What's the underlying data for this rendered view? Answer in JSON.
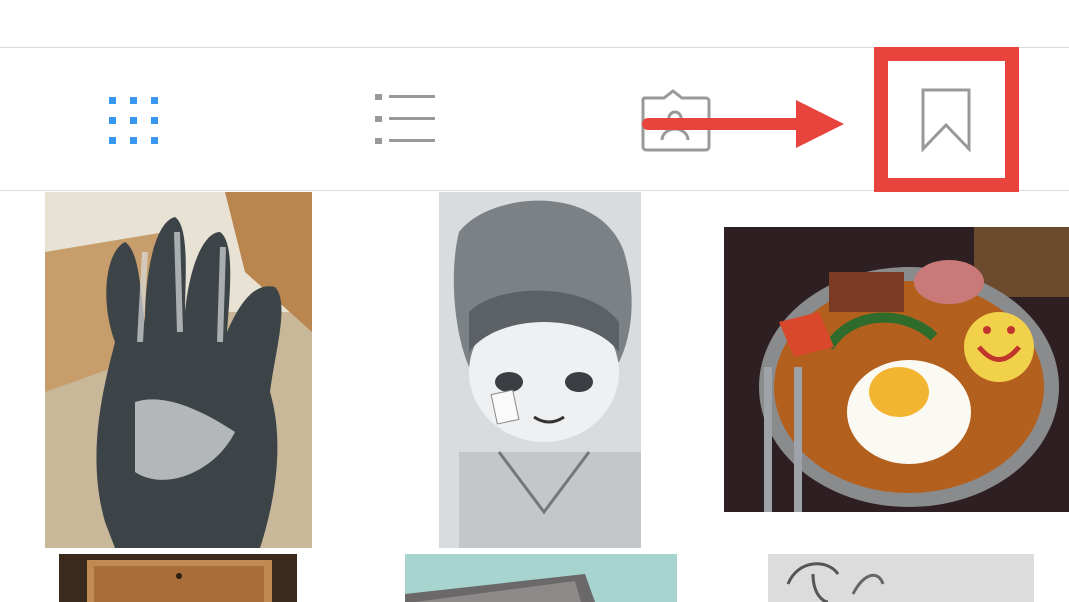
{
  "tabs": [
    {
      "id": "grid",
      "icon": "grid-icon",
      "selected": true
    },
    {
      "id": "list",
      "icon": "list-icon",
      "selected": false
    },
    {
      "id": "tagged",
      "icon": "tagged-photos-icon",
      "selected": false
    },
    {
      "id": "saved",
      "icon": "bookmark-icon",
      "selected": false,
      "highlighted": true
    }
  ],
  "colors": {
    "accent": "#3897f0",
    "inactive": "#999999",
    "annotation": "#e8443d",
    "divider": "#dbdbdb"
  },
  "annotations": {
    "arrow": "red-arrow-pointing-right",
    "highlight": "red-box-around-bookmark-tab"
  },
  "photos": [
    {
      "subject": "ink-covered-hand"
    },
    {
      "subject": "manga-sketch-girl"
    },
    {
      "subject": "curry-with-fried-egg-and-smiley-potato"
    },
    {
      "subject": "wooden-box"
    },
    {
      "subject": "tarot-card"
    },
    {
      "subject": "pencil-sketch"
    }
  ]
}
